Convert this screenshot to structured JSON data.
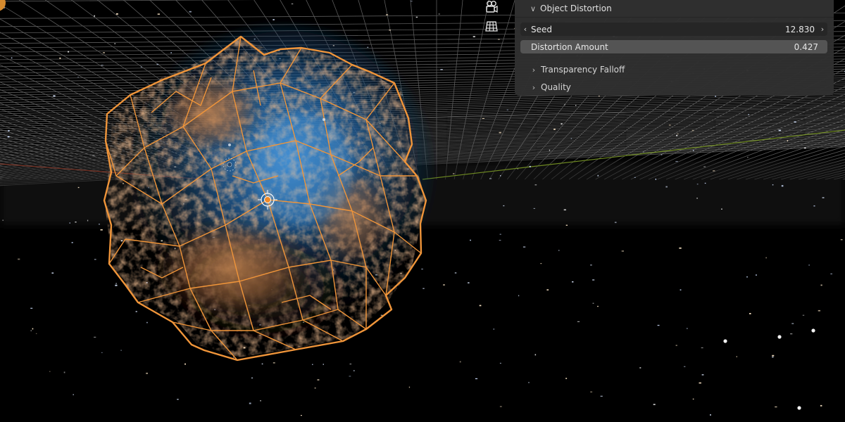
{
  "viewport": {
    "colors": {
      "background": "#000000",
      "grid": "#6a6a6a",
      "selection_wireframe": "#f0953a",
      "volume_blue": "#2f7fc4",
      "volume_orange": "#c47a45",
      "y_axis": "#7a8a2a",
      "x_axis": "#8a3a2a"
    },
    "icons": {
      "camera": "camera-icon",
      "grid": "grid-icon",
      "origin": "object-origin-icon",
      "light": "light-icon"
    }
  },
  "panel": {
    "section_title": "Object Distortion",
    "seed": {
      "label": "Seed",
      "value": "12.830"
    },
    "distortion": {
      "label": "Distortion Amount",
      "value": "0.427"
    },
    "subsections": [
      {
        "label": "Transparency Falloff"
      },
      {
        "label": "Quality"
      }
    ]
  }
}
